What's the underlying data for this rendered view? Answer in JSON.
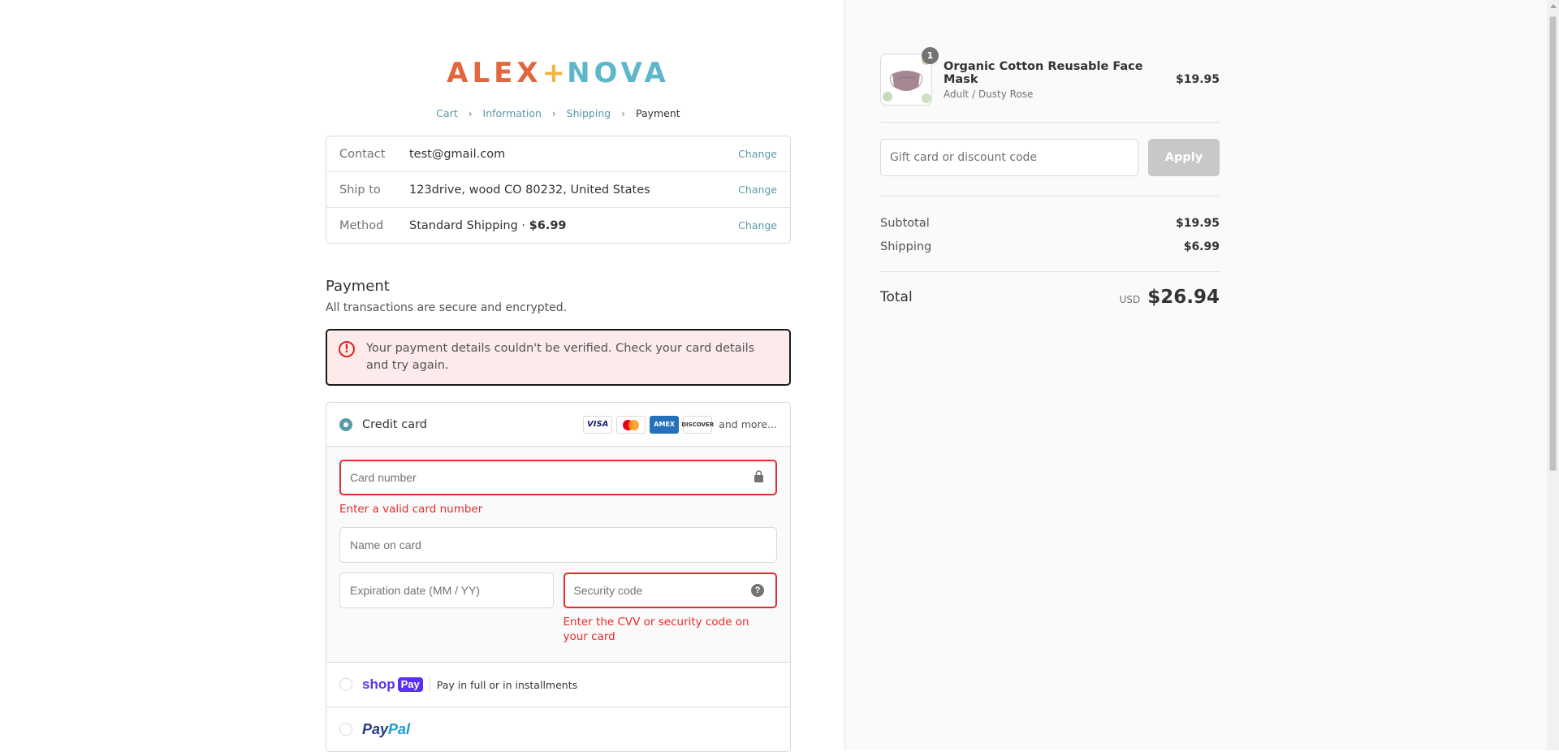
{
  "logo": {
    "part1": "ALEX",
    "plus": "+",
    "part2": "NOVA"
  },
  "breadcrumb": {
    "cart": "Cart",
    "information": "Information",
    "shipping": "Shipping",
    "payment": "Payment"
  },
  "review": {
    "contact": {
      "label": "Contact",
      "value": "test@gmail.com",
      "change": "Change"
    },
    "ship_to": {
      "label": "Ship to",
      "value": "123drive, wood CO 80232, United States",
      "change": "Change"
    },
    "method": {
      "label": "Method",
      "value": "Standard Shipping · ",
      "price": "$6.99",
      "change": "Change"
    }
  },
  "payment": {
    "title": "Payment",
    "subtitle": "All transactions are secure and encrypted.",
    "error_banner": "Your payment details couldn't be verified. Check your card details and try again.",
    "credit_card": {
      "label": "Credit card",
      "brands": [
        "VISA",
        "Mastercard",
        "AMEX",
        "DISCOVER"
      ],
      "and_more": "and more...",
      "card_number_placeholder": "Card number",
      "card_number_error": "Enter a valid card number",
      "name_placeholder": "Name on card",
      "expiry_placeholder": "Expiration date (MM / YY)",
      "security_placeholder": "Security code",
      "security_error": "Enter the CVV or security code on your card"
    },
    "shop_pay": {
      "logo": "shop",
      "logo_pay": "Pay",
      "desc": "Pay in full or in installments"
    },
    "paypal": {
      "logo1": "Pay",
      "logo2": "Pal"
    }
  },
  "summary": {
    "product": {
      "name": "Organic Cotton Reusable Face Mask",
      "variant": "Adult / Dusty Rose",
      "price": "$19.95",
      "quantity": "1"
    },
    "discount_placeholder": "Gift card or discount code",
    "apply_label": "Apply",
    "subtotal_label": "Subtotal",
    "subtotal": "$19.95",
    "shipping_label": "Shipping",
    "shipping": "$6.99",
    "total_label": "Total",
    "currency": "USD",
    "total": "$26.94"
  },
  "colors": {
    "accent": "#5a9aa7",
    "error": "#e32c2b",
    "logo_orange": "#e0673e",
    "logo_blue": "#5db6c9",
    "logo_yellow": "#f3b33d"
  }
}
